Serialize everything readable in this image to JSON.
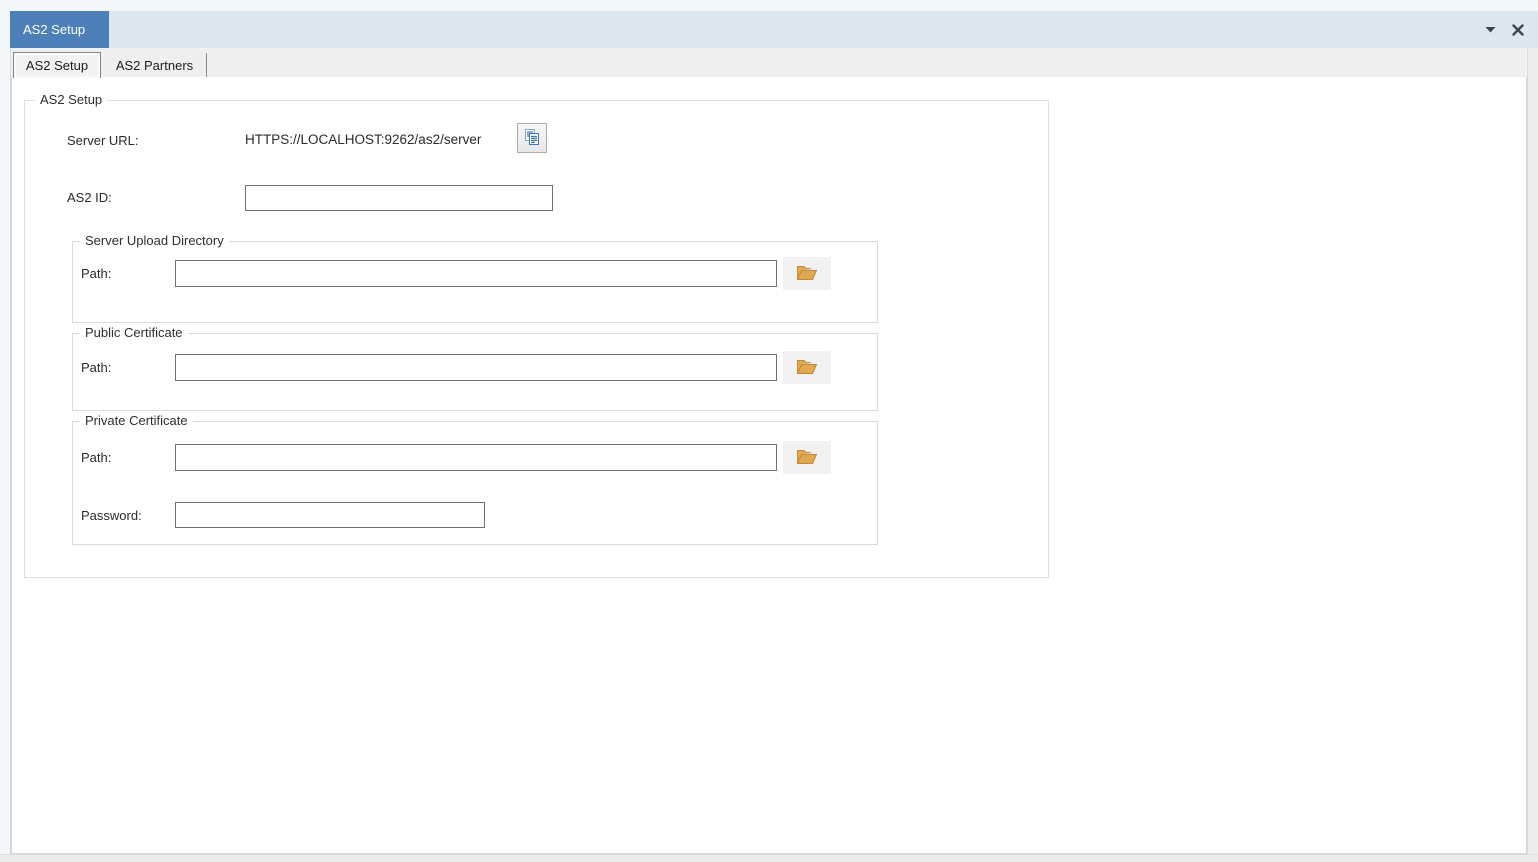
{
  "titlebar": {
    "doc_tab_label": "AS2 Setup"
  },
  "tabs": {
    "as2_setup": "AS2 Setup",
    "as2_partners": "AS2 Partners"
  },
  "form": {
    "group_title": "AS2 Setup",
    "server_url_label": "Server URL:",
    "server_url_value": "HTTPS://LOCALHOST:9262/as2/server",
    "as2_id_label": "AS2 ID:",
    "as2_id_value": "",
    "upload_group": {
      "title": "Server Upload Directory",
      "path_label": "Path:",
      "path_value": ""
    },
    "public_cert_group": {
      "title": "Public Certificate",
      "path_label": "Path:",
      "path_value": ""
    },
    "private_cert_group": {
      "title": "Private Certificate",
      "path_label": "Path:",
      "path_value": "",
      "password_label": "Password:",
      "password_value": ""
    }
  },
  "colors": {
    "accent_blue": "#4d80b8",
    "doc_bar_bg": "#dde6ef",
    "tabstrip_bg": "#efefef",
    "input_border": "#707070",
    "folder_icon_orange": "#e2a84e",
    "copy_icon_blue": "#3f76b4",
    "icon_dark": "#3f4650"
  }
}
